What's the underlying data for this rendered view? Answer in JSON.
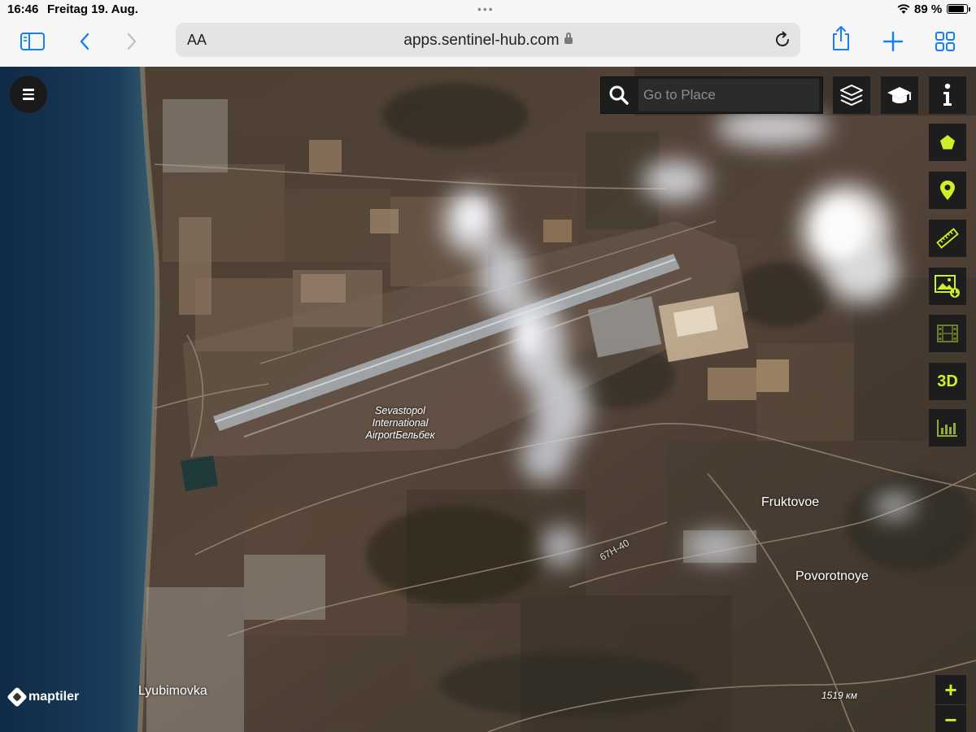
{
  "status_bar": {
    "time": "16:46",
    "date": "Freitag 19. Aug.",
    "battery_percent": "89 %",
    "battery_level": 0.89
  },
  "browser": {
    "text_size_label": "AA",
    "url": "apps.sentinel-hub.com"
  },
  "map": {
    "search_placeholder": "Go to Place",
    "airport_label_lines": [
      "Sevastopol",
      "International",
      "AirportБельбек"
    ],
    "places": {
      "fruktovoe": "Fruktovoe",
      "povorotnoye": "Povorotnoye",
      "lyubimovka": "Lyubimovka"
    },
    "road_label": "67H-40",
    "scale_label": "1519 км",
    "attribution": "maptiler",
    "tool_3d_label": "3D",
    "zoom_in": "+",
    "zoom_out": "−"
  },
  "colors": {
    "accent": "#d1ee2a",
    "browser_blue": "#147efb",
    "panel": "#1d1d1d",
    "sea": "#173351"
  },
  "icons": [
    "sidebar-icon",
    "back-icon",
    "forward-icon",
    "lock-icon",
    "reload-icon",
    "share-icon",
    "add-tab-icon",
    "tabs-grid-icon",
    "menu-icon",
    "search-icon",
    "layers-icon",
    "education-icon",
    "info-icon",
    "polygon-icon",
    "location-pin-icon",
    "ruler-icon",
    "image-download-icon",
    "film-icon",
    "chart-icon",
    "maptiler-logo-icon"
  ]
}
